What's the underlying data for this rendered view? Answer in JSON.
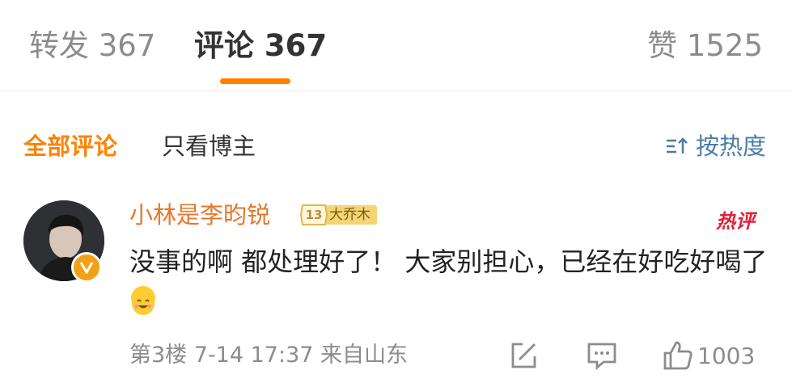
{
  "tabs": [
    {
      "label": "转发 367"
    },
    {
      "label": "评论 367"
    },
    {
      "label": "赞 1525"
    }
  ],
  "filters": {
    "all": "全部评论",
    "blogger_only": "只看博主",
    "sort": "按热度",
    "sort_icon": "sort-icon"
  },
  "comment": {
    "username": "小林是李昀锐",
    "fan_level": "13",
    "fan_group": "大乔木",
    "hot_tag": "热评",
    "text": "没事的啊 都处理好了！ 大家别担心，已经在好吃好喝了",
    "emoji": "happy-face-emoji",
    "meta": "第3楼 7-14 17:37 来自山东",
    "like_count": "1003",
    "verified_icon": "verified-v-icon"
  },
  "colors": {
    "accent": "#ff8200",
    "username": "#e5782c",
    "link": "#4b7ca6",
    "hot": "#e0203a"
  }
}
